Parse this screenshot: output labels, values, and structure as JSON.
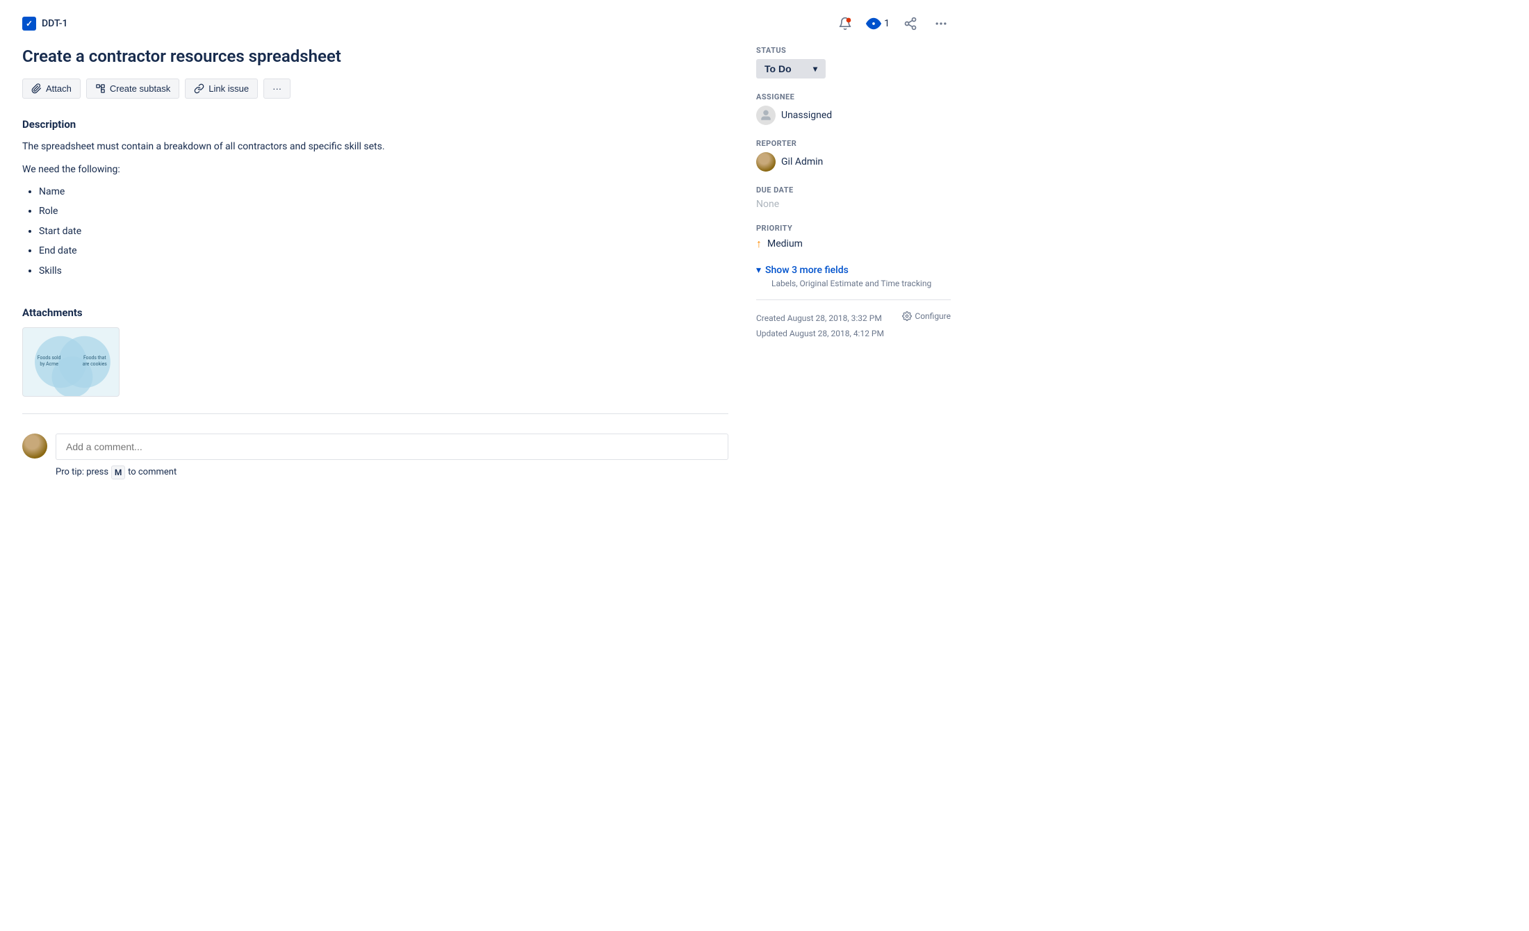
{
  "header": {
    "issue_id": "DDT-1",
    "watch_count": "1",
    "icons": {
      "bell": "📣",
      "eye": "👁",
      "share": "share-icon",
      "more": "more-icon"
    }
  },
  "issue": {
    "title": "Create a contractor resources spreadsheet",
    "buttons": {
      "attach": "Attach",
      "create_subtask": "Create subtask",
      "link_issue": "Link issue",
      "more": "···"
    },
    "description": {
      "section_title": "Description",
      "paragraph1": "The spreadsheet must contain a breakdown of all contractors and specific skill sets.",
      "paragraph2": "We need the following:",
      "bullets": [
        "Name",
        "Role",
        "Start date",
        "End date",
        "Skills"
      ]
    },
    "attachments": {
      "section_title": "Attachments"
    },
    "comment": {
      "placeholder": "Add a comment...",
      "pro_tip_prefix": "Pro tip: press",
      "pro_tip_key": "M",
      "pro_tip_suffix": "to comment"
    }
  },
  "sidebar": {
    "status_label": "STATUS",
    "status_value": "To Do",
    "assignee_label": "ASSIGNEE",
    "assignee_value": "Unassigned",
    "reporter_label": "REPORTER",
    "reporter_value": "Gil Admin",
    "due_date_label": "DUE DATE",
    "due_date_value": "None",
    "priority_label": "PRIORITY",
    "priority_value": "Medium",
    "show_more_text": "Show 3 more fields",
    "show_more_sub": "Labels, Original Estimate and Time tracking",
    "created_label": "Created August 28, 2018, 3:32 PM",
    "updated_label": "Updated August 28, 2018, 4:12 PM",
    "configure_label": "Configure"
  }
}
